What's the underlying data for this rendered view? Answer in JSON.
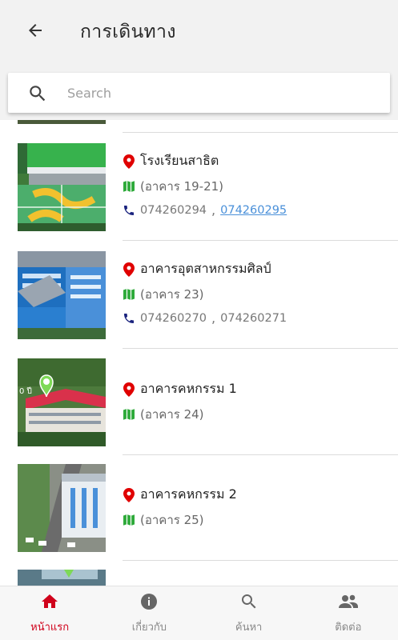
{
  "header": {
    "title": "การเดินทาง"
  },
  "search": {
    "placeholder": "Search"
  },
  "items": [
    {
      "name": "โรงเรียนสาธิต",
      "building": "(อาคาร 19-21)",
      "phone1": "074260294",
      "phone2": "074260295",
      "sep": ","
    },
    {
      "name": "อาคารอุตสาหกรรมศิลป์",
      "building": "(อาคาร 23)",
      "phone1": "074260270",
      "phone2": "074260271",
      "sep": ","
    },
    {
      "name": "อาคารคหกรรม 1",
      "building": "(อาคาร 24)"
    },
    {
      "name": "อาคารคหกรรม 2",
      "building": "(อาคาร 25)"
    }
  ],
  "nav": [
    {
      "label": "หน้าแรก",
      "icon": "home-icon",
      "active": true
    },
    {
      "label": "เกี่ยวกับ",
      "icon": "info-icon",
      "active": false
    },
    {
      "label": "ค้นหา",
      "icon": "search-icon",
      "active": false
    },
    {
      "label": "ติดต่อ",
      "icon": "contacts-icon",
      "active": false
    }
  ],
  "colors": {
    "accent": "#d0021b",
    "pin": "#e00000",
    "map": "#2eaa3a",
    "phone": "#1a237e",
    "link": "#4a90d9"
  }
}
